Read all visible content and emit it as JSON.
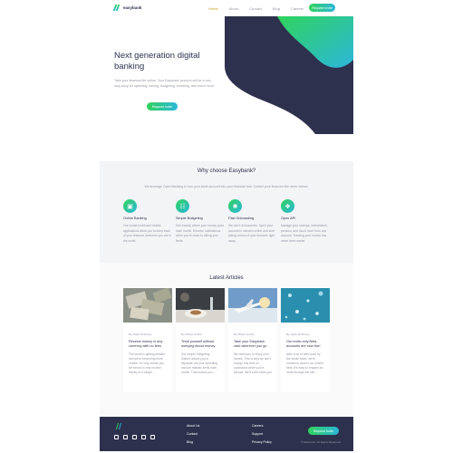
{
  "nav": {
    "brand": "easybank",
    "links": [
      "Home",
      "About",
      "Contact",
      "Blog",
      "Careers"
    ],
    "cta": "Request Invite"
  },
  "hero": {
    "title": "Next generation digital banking",
    "description": "Take your financial life online. Your Easybank account will be a one-stop-shop for spending, saving, budgeting, investing, and much more.",
    "cta": "Request Invite"
  },
  "why": {
    "title": "Why choose Easybank?",
    "subtitle": "We leverage Open Banking to turn your bank account into your financial hub. Control your finances like never before.",
    "features": [
      {
        "icon": "online-banking-icon",
        "title": "Online Banking",
        "desc": "Our modern web and mobile applications allow you to keep track of your finances wherever you are in the world."
      },
      {
        "icon": "budgeting-icon",
        "title": "Simple Budgeting",
        "desc": "See exactly where your money goes each month. Receive notifications when you're close to hitting your limits."
      },
      {
        "icon": "onboarding-icon",
        "title": "Fast Onboarding",
        "desc": "We don't do branches. Open your account in minutes online and start taking control of your finances right away."
      },
      {
        "icon": "api-icon",
        "title": "Open API",
        "desc": "Manage your savings, investments, pension, and much more from one account. Tracking your money has never been easier."
      }
    ]
  },
  "articles": {
    "title": "Latest Articles",
    "items": [
      {
        "author": "By Claire Robinson",
        "title": "Receive money in any currency with no fees",
        "text": "The world is getting smaller and we're becoming more mobile. So why should you be forced to only receive money in a single ..."
      },
      {
        "author": "By Wilson Hutton",
        "title": "Treat yourself without worrying about money",
        "text": "Our simple budgeting feature allows you to separate out your spending and set realistic limits each month. That means you ..."
      },
      {
        "author": "By Wilson Hutton",
        "title": "Take your Easybank card wherever you go",
        "text": "We want you to enjoy your travels. This is why we don't charge any fees on purchases while you're abroad. We'll even show you ..."
      },
      {
        "author": "By Claire Robinson",
        "title": "Our invite-only Beta accounts are now live!",
        "text": "After a lot of hard work by the whole team, we're excited to launch our closed beta. It's easy to request an invite through the site ..."
      }
    ]
  },
  "footer": {
    "col1": [
      "About Us",
      "Contact",
      "Blog"
    ],
    "col2": [
      "Careers",
      "Support",
      "Privacy Policy"
    ],
    "cta": "Request Invite",
    "copyright": "© Easybank. All Rights Reserved"
  },
  "colors": {
    "navy": "#2d314d",
    "green": "#31d35c",
    "cyan": "#2bb7da",
    "gray": "#9698a6"
  }
}
